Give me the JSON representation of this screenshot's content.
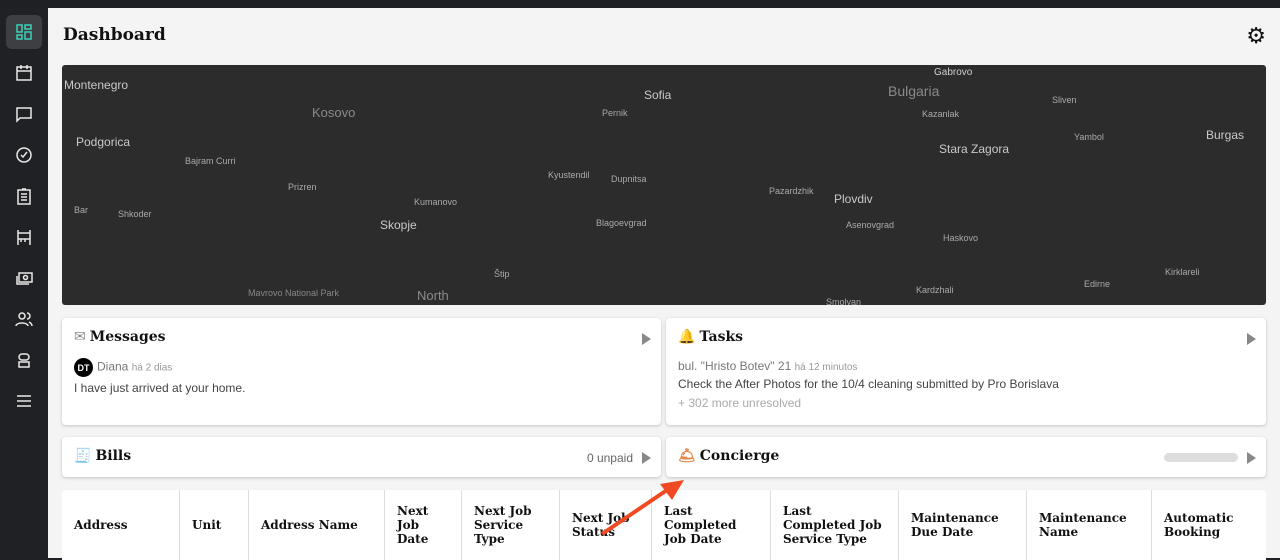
{
  "header": {
    "title": "Dashboard"
  },
  "sidebar": {
    "items": [
      "dashboard",
      "calendar",
      "messages",
      "tasks",
      "checklist",
      "properties",
      "payments",
      "team",
      "concierge",
      "menu"
    ]
  },
  "map": {
    "labels": [
      "Montenegro",
      "Kosovo",
      "Sofia",
      "Bulgaria",
      "Gabrovo",
      "Podgorica",
      "Bajram Curri",
      "Pernik",
      "Kazanlak",
      "Sliven",
      "Yambol",
      "Burgas",
      "Prizren",
      "Kyustendil",
      "Dupnitsa",
      "Stara Zagora",
      "Bar",
      "Shkoder",
      "Kumanovo",
      "Skopje",
      "Blagoevgrad",
      "Pazardzhik",
      "Plovdiv",
      "Asenovgrad",
      "Haskovo",
      "Štip",
      "Mavrovo National Park",
      "North",
      "Smolyan",
      "Kardzhali",
      "Edirne",
      "Kirklareli"
    ]
  },
  "messages": {
    "title": "Messages",
    "avatar": "DT",
    "sender": "Diana",
    "time": "há 2 dias",
    "body": "I have just arrived at your home."
  },
  "tasks": {
    "title": "Tasks",
    "address": "bul. \"Hristo Botev\" 21",
    "time": "há 12 minutos",
    "body": "Check the After Photos for the 10/4 cleaning submitted by Pro Borislava",
    "more": "+ 302 more unresolved"
  },
  "bills": {
    "title": "Bills",
    "status": "0 unpaid"
  },
  "concierge": {
    "title": "Concierge"
  },
  "table": {
    "columns": [
      "Address",
      "Unit",
      "Address Name",
      "Next Job Date",
      "Next Job Service Type",
      "Next Job Status",
      "Last Completed Job Date",
      "Last Completed Job Service Type",
      "Maintenance Due Date",
      "Maintenance Name",
      "Automatic Booking"
    ]
  },
  "colors": {
    "accent": "#3fd0b7",
    "arrow": "#f04a23"
  }
}
